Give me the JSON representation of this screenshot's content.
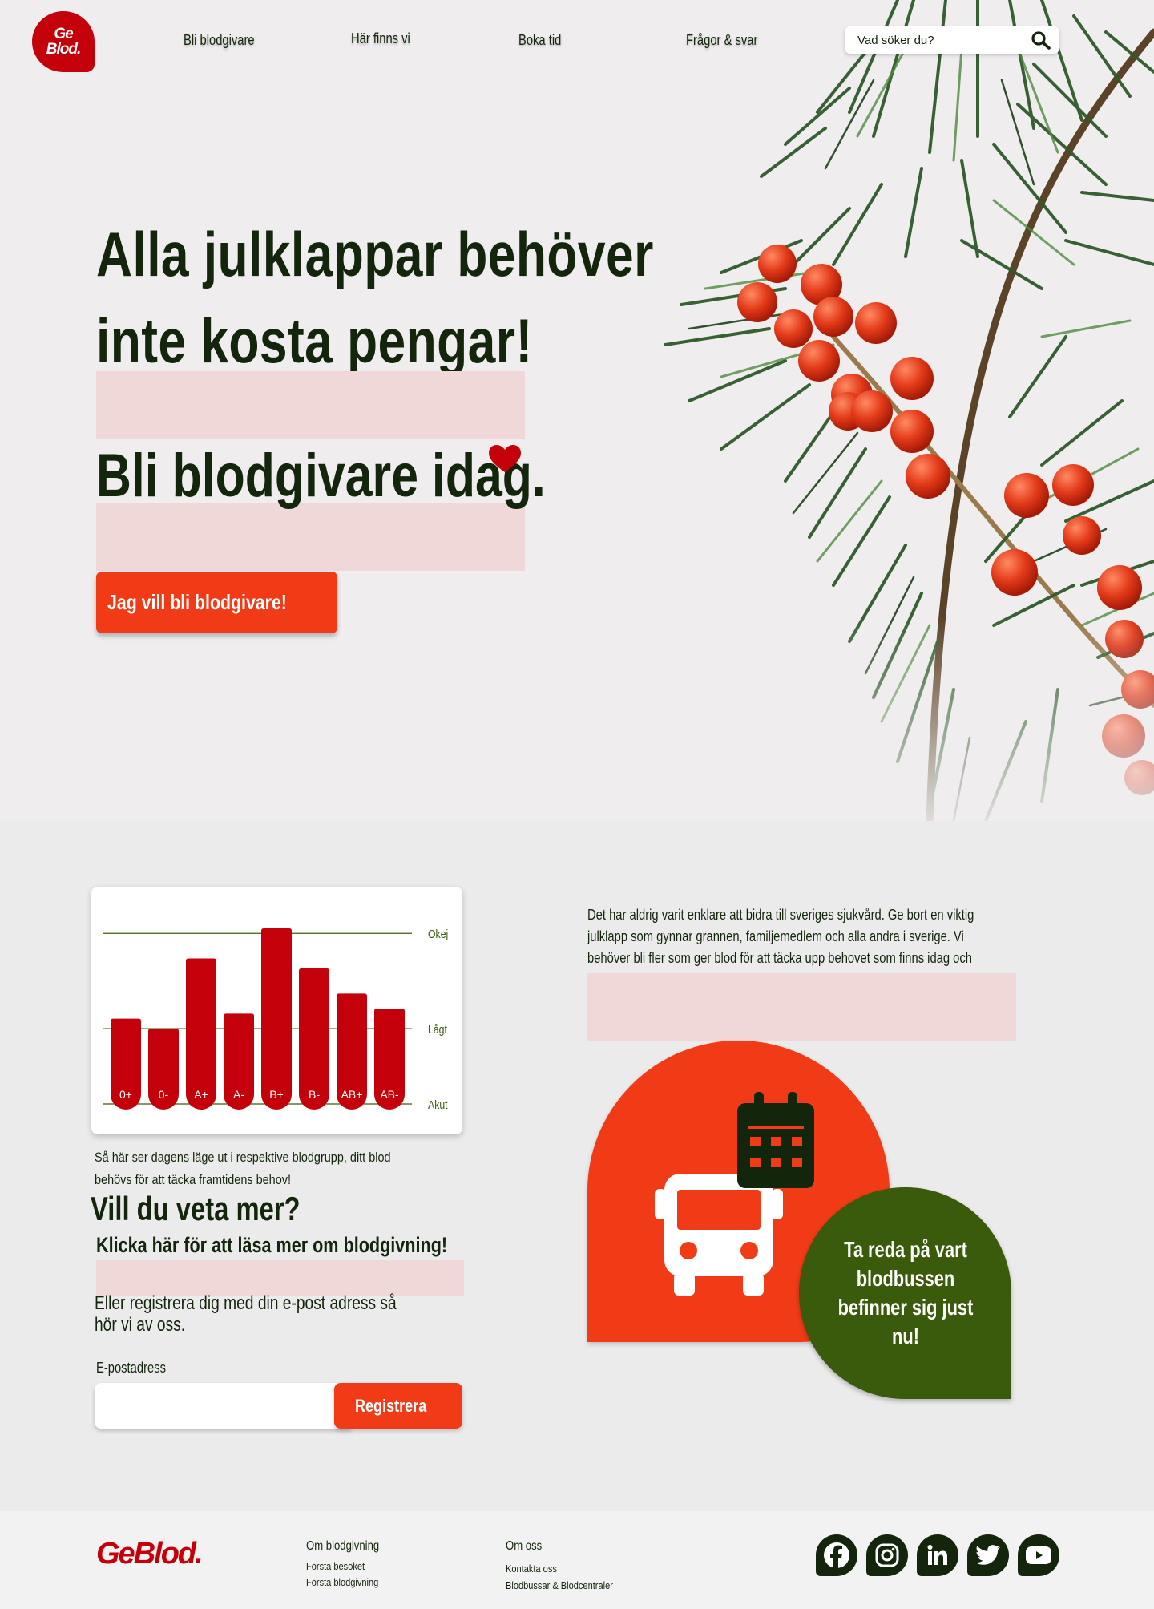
{
  "brand": {
    "logo_line1": "Ge",
    "logo_line2": "Blod.",
    "footer_logo": "GeBlod."
  },
  "nav": {
    "items": [
      "Bli blodgivare",
      "Här finns vi",
      "Boka tid",
      "Frågor & svar"
    ],
    "search_placeholder": "Vad söker du?"
  },
  "hero": {
    "headline_line1": "Alla julklappar behöver",
    "headline_line2": "inte kosta pengar!",
    "subheadline": "Bli blodgivare idag.",
    "cta_label": "Jag vill bli blodgivare!"
  },
  "chart_data": {
    "type": "bar",
    "categories": [
      "0+",
      "0-",
      "A+",
      "A-",
      "B+",
      "B-",
      "AB+",
      "AB-"
    ],
    "values": [
      0.64,
      0.6,
      0.88,
      0.66,
      1.0,
      0.84,
      0.74,
      0.68
    ],
    "reference_lines": [
      {
        "label": "Okej",
        "value": 0.98
      },
      {
        "label": "Lågt",
        "value": 0.6
      },
      {
        "label": "Akut",
        "value": 0.3
      }
    ],
    "ylim": [
      0.3,
      1.0
    ],
    "bar_color": "#c4000b",
    "line_color": "#3a5b0b"
  },
  "chart_caption": "Så här ser dagens läge ut i respektive blodgrupp, ditt blod behövs för att täcka framtidens behov!",
  "info": {
    "heading": "Vill du veta mer?",
    "read_more_link": "Klicka här för att läsa mer om blodgivning!",
    "register_text": "Eller registrera dig med din e-post adress så hör vi av oss.",
    "email_label": "E-postadress",
    "email_value": "",
    "register_button": "Registrera"
  },
  "intro_text": "Det har aldrig varit enklare att bidra till sveriges sjukvård. Ge bort en viktig julklapp som gynnar grannen, familjemedlem och alla andra i sverige. Vi behöver bli fler som ger blod för att täcka upp behovet som finns idag och kommer att finnas i framtiden.",
  "bus_tile": {
    "icons": [
      "bus-icon",
      "calendar-icon"
    ]
  },
  "bus_cta": "Ta reda på vart blodbussen befinner sig just nu!",
  "footer": {
    "col1": {
      "title": "Om blodgivning",
      "links": [
        "Första besöket",
        "Första blodgivning"
      ]
    },
    "col2": {
      "title": "Om oss",
      "links": [
        "Kontakta oss",
        "Blodbussar & Blodcentraler"
      ]
    },
    "social": [
      "facebook-icon",
      "instagram-icon",
      "linkedin-icon",
      "twitter-icon",
      "youtube-icon"
    ]
  },
  "colors": {
    "accent": "#f03b16",
    "brand_red": "#c4000b",
    "dark_green": "#13260c",
    "green": "#3a5b0b",
    "pink_highlight": "#f0d8d8"
  }
}
